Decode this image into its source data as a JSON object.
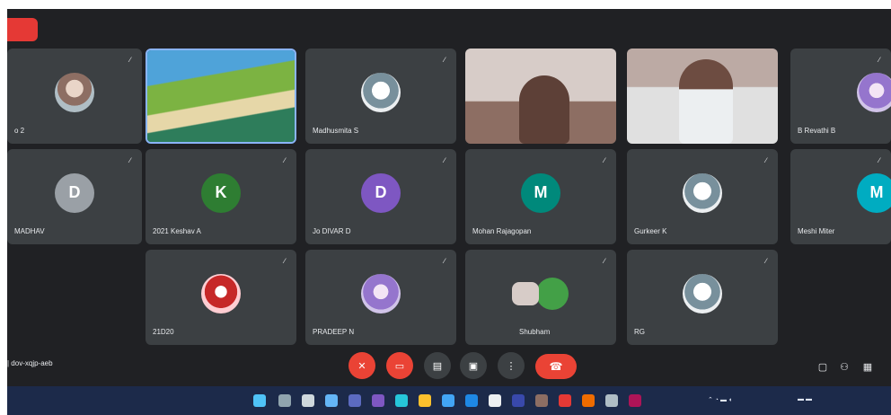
{
  "recording_badge": "",
  "participants": [
    {
      "name": "o 2",
      "avatar": "photo-avatar",
      "letter": ""
    },
    {
      "name": "",
      "avatar": "beach",
      "letter": ""
    },
    {
      "name": "Madhusmita S",
      "avatar": "photo-avatar-3",
      "letter": ""
    },
    {
      "name": "",
      "avatar": "video-a",
      "letter": ""
    },
    {
      "name": "",
      "avatar": "video-b",
      "letter": ""
    },
    {
      "name": "B Revathi B",
      "avatar": "photo-avatar-2",
      "letter": ""
    },
    {
      "name": "MADHAV",
      "avatar": "",
      "letter": "D",
      "color": "#9aa0a6"
    },
    {
      "name": "2021 Keshav A",
      "avatar": "",
      "letter": "K",
      "color": "#2e7d32"
    },
    {
      "name": "Jo DIVAR D",
      "avatar": "",
      "letter": "D",
      "color": "#7e57c2"
    },
    {
      "name": "Mohan Rajagopan",
      "avatar": "",
      "letter": "M",
      "color": "#00897b"
    },
    {
      "name": "Gurkeer K",
      "avatar": "photo-avatar-3",
      "letter": ""
    },
    {
      "name": "Meshi Miter",
      "avatar": "",
      "letter": "M",
      "color": "#00acc1"
    },
    {
      "name": "21D20",
      "avatar": "photo-avatar-4",
      "letter": ""
    },
    {
      "name": "PRADEEP N",
      "avatar": "photo-avatar-2",
      "letter": ""
    },
    {
      "name": "Shubham",
      "avatar": "",
      "letter": "",
      "color": "#43a047"
    },
    {
      "name": "RG",
      "avatar": "photo-avatar-3",
      "letter": ""
    }
  ],
  "controls": {
    "meeting_info": "| dov-xqjp-aeb",
    "mic_icon": "mic-off-icon",
    "cam_icon": "camera-off-icon",
    "captions_icon": "captions-icon",
    "present_icon": "present-icon",
    "more_icon": "more-icon",
    "end_call_icon": "end-call-icon"
  },
  "colors": {
    "background": "#202124",
    "tile": "#3c4043",
    "danger": "#ea4335",
    "taskbar": "#1c2a4a"
  }
}
